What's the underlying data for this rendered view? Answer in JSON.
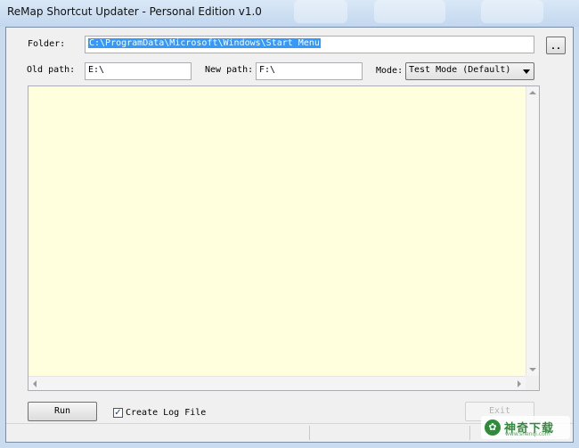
{
  "window": {
    "title": "ReMap Shortcut Updater - Personal Edition v1.0"
  },
  "form": {
    "folder_label": "Folder:",
    "folder_value": "C:\\ProgramData\\Microsoft\\Windows\\Start Menu",
    "browse_label": "..",
    "old_path_label": "Old path:",
    "old_path_value": "E:\\",
    "new_path_label": "New path:",
    "new_path_value": "F:\\",
    "mode_label": "Mode:",
    "mode_value": "Test Mode (Default)"
  },
  "log": {
    "content": ""
  },
  "footer": {
    "run_label": "Run",
    "create_log_label": "Create Log File",
    "create_log_checked": true,
    "exit_label": "Exit"
  },
  "watermark": {
    "text": "神奇下载",
    "url": "www.shenqi.com"
  },
  "colors": {
    "log_background": "#ffffde",
    "selection": "#3399ff",
    "title_bar": "#c9dcef"
  }
}
